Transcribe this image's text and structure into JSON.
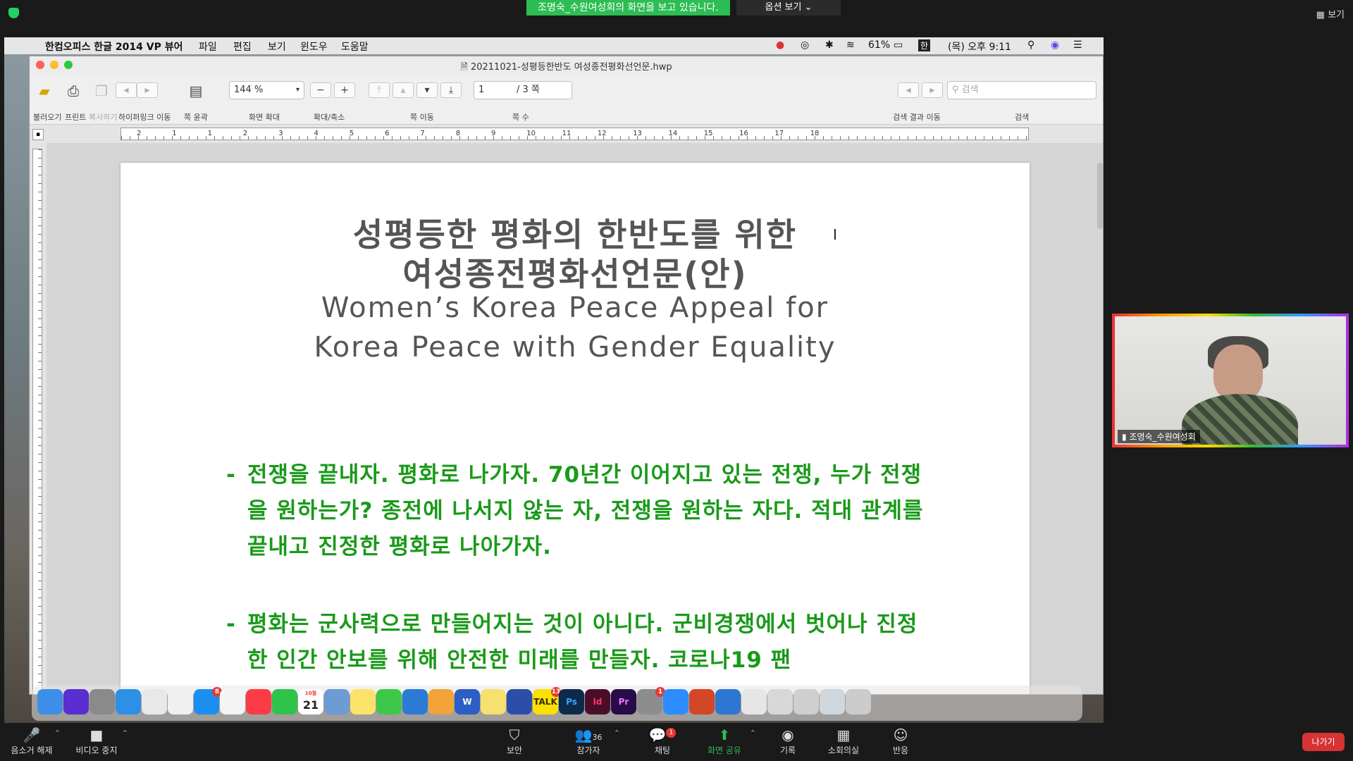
{
  "zoom_top": {
    "sharing_banner": "조명숙_수원여성회의 화면을 보고 있습니다.",
    "view_options": "옵션 보기 ⌄",
    "view_button": "▦ 보기"
  },
  "menubar": {
    "app_name": "한컴오피스 한글 2014 VP 뷰어",
    "menus": [
      "파일",
      "편집",
      "보기",
      "윈도우",
      "도움말"
    ],
    "battery": "61%",
    "input_lang": "한",
    "clock": "(목) 오후 9:11"
  },
  "window": {
    "file_title": "20211021-성평등한반도 여성종전평화선언문.hwp",
    "toolbar": {
      "zoom_value": "144 %",
      "page_current": "1",
      "page_total": "/ 3 쪽",
      "search_placeholder": "검색",
      "labels": {
        "open": "불러오기",
        "print": "프린트",
        "copy": "복사하기",
        "hyperlink": "하이퍼링크 이동",
        "outline": "쪽 윤곽",
        "zoom": "화면 확대",
        "zoom_inout": "확대/축소",
        "page_move": "쪽 이동",
        "page_count": "쪽 수",
        "search_nav": "검색 결과 이동",
        "search": "검색"
      }
    },
    "ruler_numbers": [
      "2",
      "1",
      "1",
      "2",
      "3",
      "4",
      "5",
      "6",
      "7",
      "8",
      "9",
      "10",
      "11",
      "12",
      "13",
      "14",
      "15",
      "16",
      "17",
      "18"
    ]
  },
  "document": {
    "title_kr_1": "성평등한 평화의 한반도를 위한",
    "title_kr_2": "여성종전평화선언문(안)",
    "title_en_1": "Women’s Korea Peace Appeal for",
    "title_en_2": "Korea Peace with Gender Equality",
    "paragraphs": [
      {
        "dash": "-",
        "text": "전쟁을 끝내자. 평화로 나가자. 70년간 이어지고 있는 전쟁, 누가 전쟁을 원하는가? 종전에 나서지 않는 자, 전쟁을 원하는 자다. 적대 관계를 끝내고 진정한 평화로 나아가자."
      },
      {
        "dash": "-",
        "text": "평화는 군사력으로 만들어지는 것이 아니다. 군비경쟁에서 벗어나 진정한 인간 안보를 위해 안전한 미래를 만들자. 코로나19 팬"
      }
    ]
  },
  "dock": {
    "calendar_day": "21",
    "calendar_month": "10월",
    "apps": [
      "finder",
      "siri",
      "launchpad",
      "safari",
      "chrome",
      "gesture",
      "appstore",
      "photos",
      "music",
      "facetime",
      "calendar",
      "preview",
      "notes",
      "messages",
      "keynote-prez",
      "pages",
      "word",
      "stickies",
      "direct",
      "kakaotalk",
      "photoshop",
      "indesign",
      "premiere",
      "system-prefs",
      "zoom",
      "powerpoint",
      "hwp",
      "itunes",
      "mail-doc",
      "folder-a",
      "folder-b",
      "trash"
    ],
    "labels": {
      "kakaotalk": "TALK",
      "photoshop": "Ps",
      "indesign": "Id",
      "premiere": "Pr",
      "word": "W"
    },
    "badges": {
      "appstore": "8",
      "kakaotalk": "13",
      "system-prefs": "1"
    }
  },
  "participant": {
    "name": "조영숙_수원여성회"
  },
  "zoom_bottom": {
    "unmute": "음소거 해제",
    "stop_video": "비디오 중지",
    "security": "보안",
    "participants": "참가자",
    "participants_count": "36",
    "chat": "채팅",
    "chat_badge": "1",
    "share": "화면 공유",
    "record": "기록",
    "breakout": "소회의실",
    "reactions": "반응",
    "leave": "나가기"
  },
  "colors": {
    "banner_green": "#2dbd52",
    "doc_green_text": "#1a9a1a",
    "leave_red": "#d63333"
  }
}
